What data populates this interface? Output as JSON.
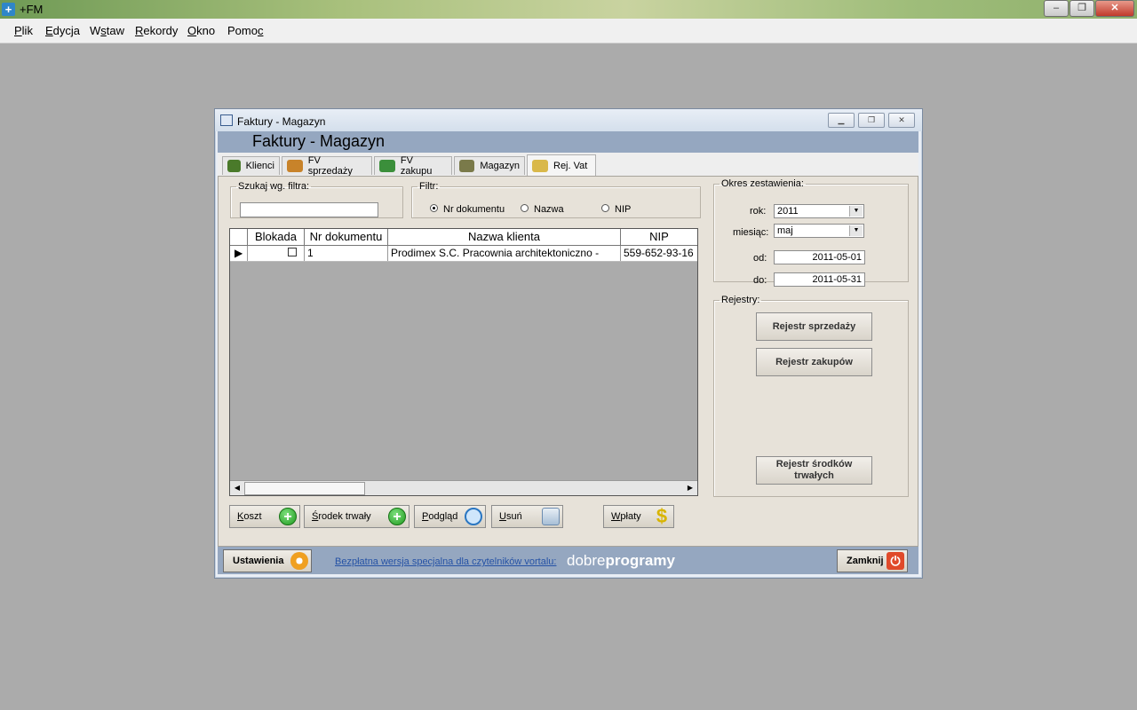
{
  "app": {
    "title": "+FM",
    "window_buttons": [
      "–",
      "❐",
      "✕"
    ]
  },
  "menu": [
    {
      "pre": "",
      "u": "P",
      "post": "lik"
    },
    {
      "pre": "",
      "u": "E",
      "post": "dycja"
    },
    {
      "pre": "W",
      "u": "s",
      "post": "taw"
    },
    {
      "pre": "",
      "u": "R",
      "post": "ekordy"
    },
    {
      "pre": "",
      "u": "O",
      "post": "kno"
    },
    {
      "pre": "Pomo",
      "u": "c",
      "post": ""
    }
  ],
  "window": {
    "title": "Faktury - Magazyn",
    "header": "Faktury - Magazyn"
  },
  "tabs": [
    {
      "label": "Klienci",
      "icon": "clients-icon",
      "color": "#4a7a2a"
    },
    {
      "label": "FV sprzedaży",
      "icon": "house-icon",
      "color": "#c8832a"
    },
    {
      "label": "FV zakupu",
      "icon": "cart-icon",
      "color": "#3b8f3b"
    },
    {
      "label": "Magazyn",
      "icon": "boxes-icon",
      "color": "#7a7a4a"
    },
    {
      "label": "Rej. Vat",
      "icon": "book-icon",
      "color": "#d9b84a",
      "active": true
    }
  ],
  "search": {
    "legend": "Szukaj wg. filtra:",
    "value": ""
  },
  "filter": {
    "legend": "Filtr:",
    "options": [
      {
        "label": "Nr dokumentu",
        "selected": true
      },
      {
        "label": "Nazwa",
        "selected": false
      },
      {
        "label": "NIP",
        "selected": false
      }
    ]
  },
  "grid": {
    "columns": [
      "Blokada",
      "Nr dokumentu",
      "Nazwa klienta",
      "NIP"
    ],
    "rows": [
      {
        "blokada": false,
        "nr": "1",
        "nazwa": "Prodimex S.C. Pracownia architektoniczno -",
        "nip": "559-652-93-16"
      }
    ]
  },
  "buttons": {
    "koszt": {
      "u": "K",
      "rest": "oszt"
    },
    "srodek": {
      "u": "Ś",
      "rest": "rodek trwały"
    },
    "podglad": {
      "u": "P",
      "rest": "odgląd"
    },
    "usun": {
      "u": "U",
      "rest": "suń"
    },
    "wplaty": {
      "u": "W",
      "rest": "płaty"
    }
  },
  "okres": {
    "legend": "Okres zestawienia:",
    "rok_label": "rok:",
    "rok_value": "2011",
    "miesiac_label": "miesiąc:",
    "miesiac_value": "maj",
    "od_label": "od:",
    "od_value": "2011-05-01",
    "do_label": "do:",
    "do_value": "2011-05-31"
  },
  "rejestry": {
    "legend": "Rejestry:",
    "sprzedazy": "Rejestr sprzedaży",
    "zakupow": "Rejestr zakupów",
    "srodkow_line1": "Rejestr środków",
    "srodkow_line2": "trwałych"
  },
  "footer": {
    "ustawienia": "Ustawienia",
    "promo": "Bezpłatna wersja specjalna dla czytelników vortalu:",
    "brand_light": "dobre",
    "brand_bold": "programy",
    "zamknij": "Zamknij"
  }
}
